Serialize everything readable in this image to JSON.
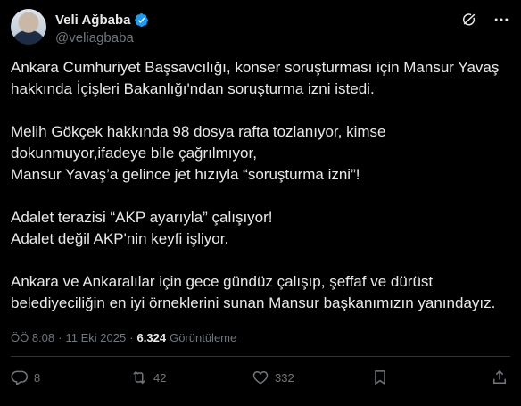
{
  "author": {
    "display_name": "Veli Ağbaba",
    "handle": "@veliagbaba",
    "verified_icon": "verified-badge-icon",
    "accent_color": "#1d9bf0"
  },
  "header_icons": [
    "grok-icon",
    "more-icon"
  ],
  "tweet": {
    "paragraphs": [
      [
        "Ankara Cumhuriyet Başsavcılığı, konser soruşturması için Mansur Yavaş",
        "hakkında İçişleri Bakanlığı'ndan soruşturma izni istedi."
      ],
      [
        "Melih Gökçek hakkında 98 dosya rafta tozlanıyor, kimse",
        "dokunmuyor,ifadeye bile çağrılmıyor,",
        "Mansur Yavaş’a gelince jet hızıyla “soruşturma izni”!"
      ],
      [
        "Adalet terazisi “AKP ayarıyla” çalışıyor!",
        "Adalet değil AKP'nin keyfi işliyor."
      ],
      [
        "Ankara ve Ankaralılar için gece gündüz çalışıp, şeffaf ve dürüst",
        "belediyeciliğin en iyi örneklerini sunan Mansur başkanımızın yanındayız."
      ]
    ]
  },
  "meta": {
    "time": "ÖÖ 8:08",
    "separator": "·",
    "date": "11 Eki 2025",
    "view_count": "6.324",
    "views_label": "Görüntüleme"
  },
  "actions": {
    "replies": "8",
    "reposts": "42",
    "likes": "332"
  }
}
